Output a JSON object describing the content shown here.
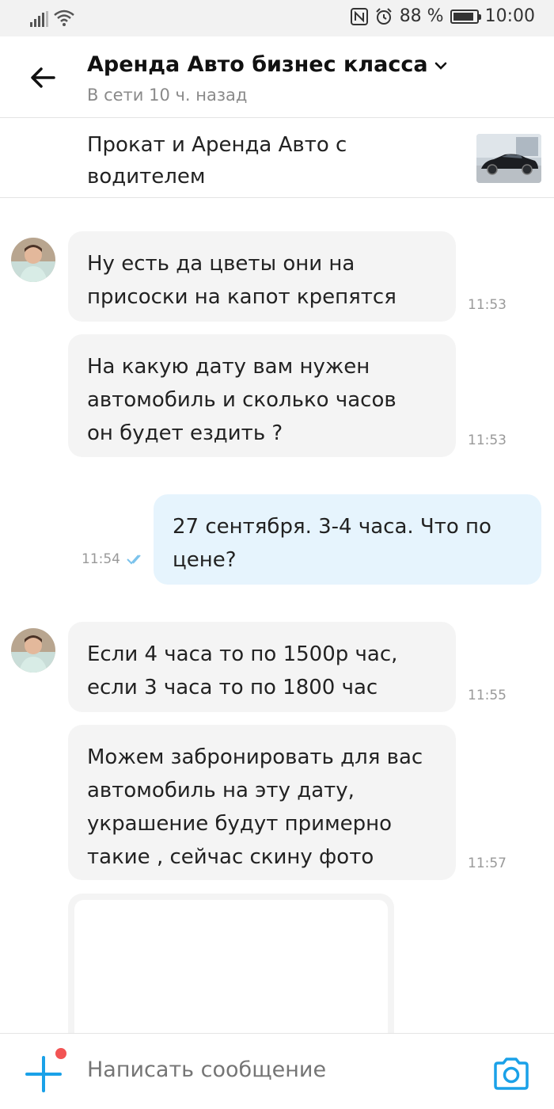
{
  "status_bar": {
    "battery_percent": "88 %",
    "battery_level": 0.88,
    "time": "10:00",
    "icons": [
      "signal-icon",
      "wifi-icon",
      "nfc-icon",
      "alarm-icon",
      "battery-icon"
    ]
  },
  "header": {
    "title": "Аренда Авто бизнес класса",
    "subtitle": "В сети 10 ч. назад",
    "icons": [
      "back-arrow-icon",
      "chevron-down-icon"
    ]
  },
  "product": {
    "title": "Прокат и Аренда Авто с водителем"
  },
  "messages": [
    {
      "direction": "in",
      "text": "Ну есть да цветы они на\nприсоски на капот крепятся",
      "time": "11:53"
    },
    {
      "direction": "in",
      "text": "На какую дату вам нужен\nавтомобиль и сколько часов\nон будет ездить ?",
      "time": "11:53"
    },
    {
      "direction": "out",
      "text": "27 сентября. 3-4 часа. Что по\nцене?",
      "time": "11:54",
      "read": true
    },
    {
      "direction": "in",
      "text": "Если 4 часа то по 1500р час,\nесли 3 часа то по 1800 час",
      "time": "11:55"
    },
    {
      "direction": "in",
      "text": "Можем забронировать для вас\nавтомобиль на эту дату,\nукрашение будут примерно\nтакие , сейчас скину фото",
      "time": "11:57"
    }
  ],
  "composer": {
    "placeholder": "Написать сообщение",
    "icons": [
      "plus-icon",
      "camera-icon"
    ]
  },
  "colors": {
    "accent": "#1aa1e8",
    "incoming_bubble": "#f4f4f4",
    "outgoing_bubble": "#e6f4fd",
    "notification_dot": "#f25454"
  }
}
